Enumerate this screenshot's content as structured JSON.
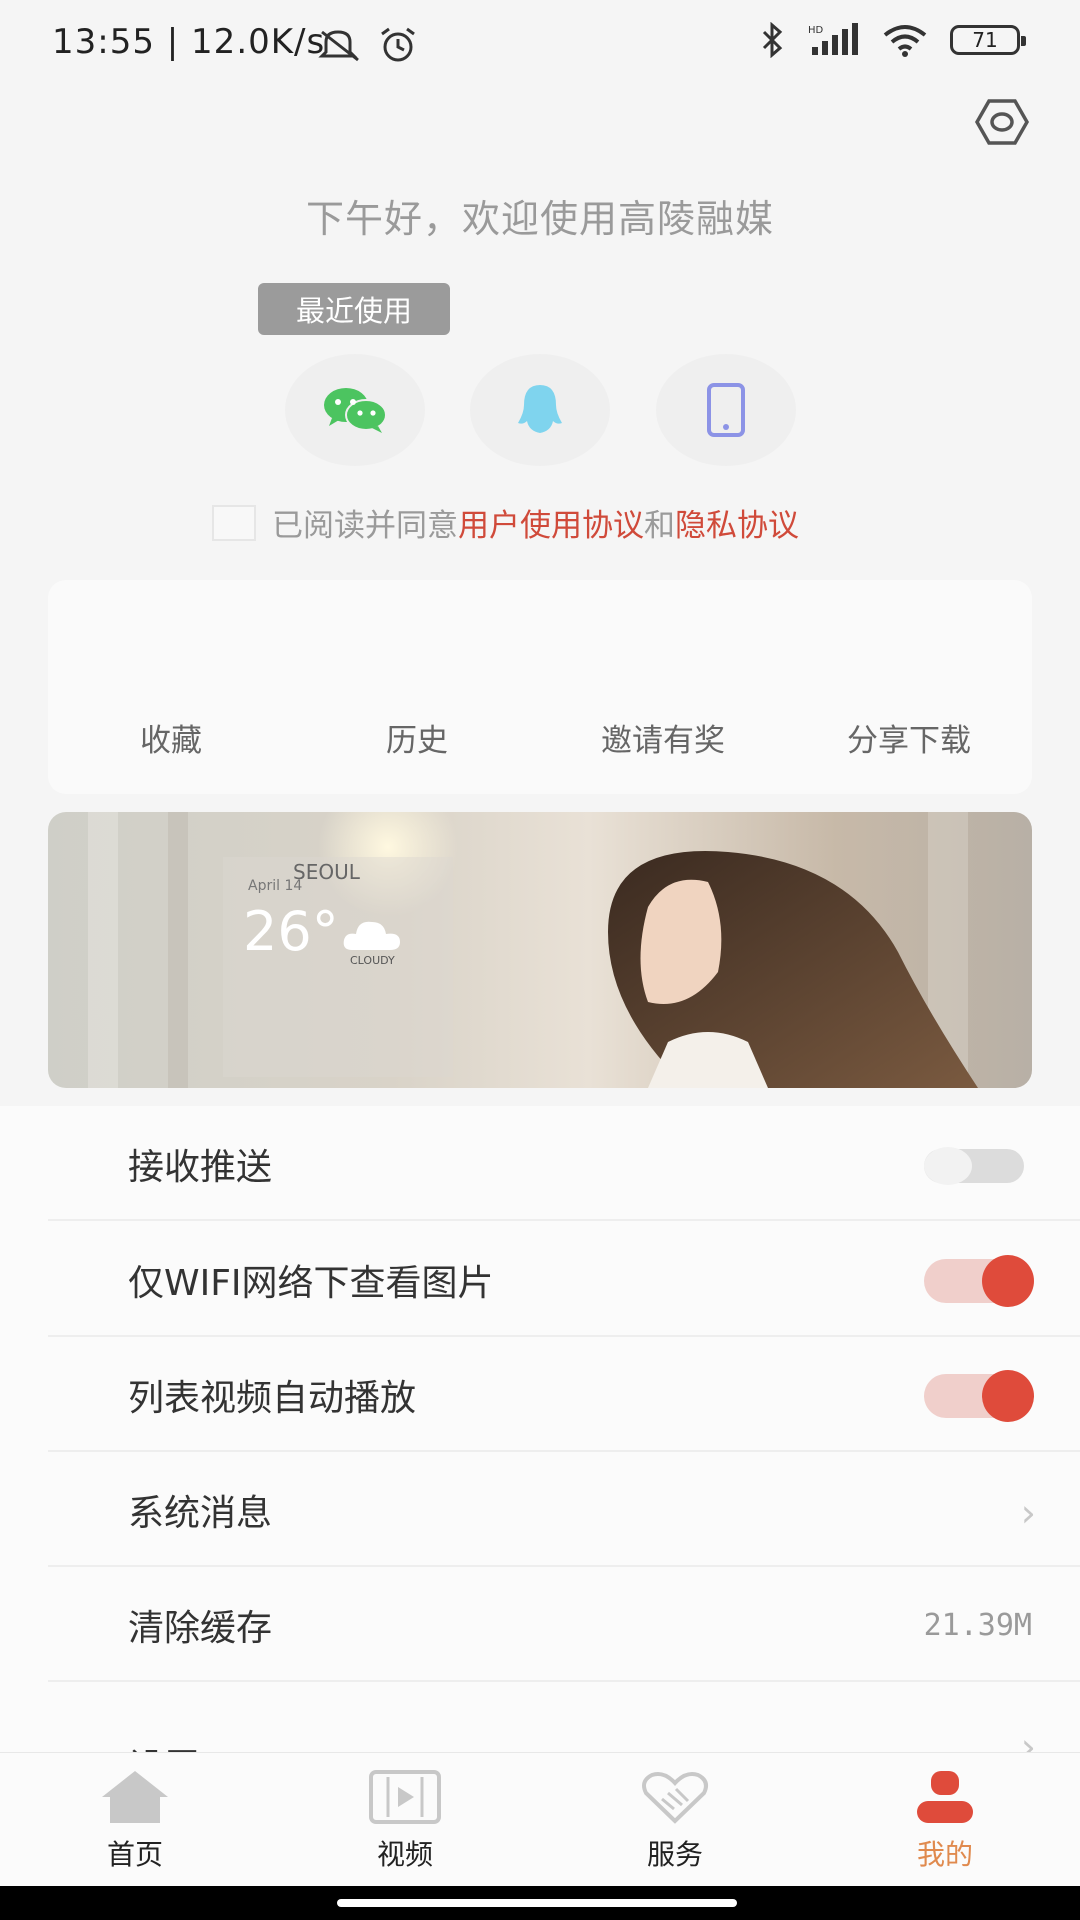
{
  "status_bar": {
    "time": "13:55 | 12.0K/s",
    "battery": "71"
  },
  "header": {
    "greeting": "下午好，欢迎使用高陵融媒",
    "recent_tag": "最近使用"
  },
  "login_options": [
    {
      "icon": "wechat-icon",
      "color": "#4cc460"
    },
    {
      "icon": "qq-icon",
      "color": "#7fd4ee"
    },
    {
      "icon": "phone-icon",
      "color": "#8c93e6"
    }
  ],
  "agreement": {
    "prefix": "已阅读并同意",
    "user_agreement": "用户使用协议",
    "and": "和",
    "privacy": "隐私协议"
  },
  "quick_actions": [
    "收藏",
    "历史",
    "邀请有奖",
    "分享下载"
  ],
  "banner": {
    "city": "SEOUL",
    "date": "April 14",
    "temperature": "26°",
    "condition": "CLOUDY"
  },
  "settings": {
    "push": {
      "label": "接收推送",
      "enabled": false
    },
    "wifi_images": {
      "label": "仅WIFI网络下查看图片",
      "enabled": true
    },
    "autoplay": {
      "label": "列表视频自动播放",
      "enabled": true
    },
    "messages": {
      "label": "系统消息"
    },
    "cache": {
      "label": "清除缓存",
      "value": "21.39M"
    },
    "settings": {
      "label": "设置"
    }
  },
  "bottom_nav": [
    {
      "label": "首页",
      "icon": "home-icon",
      "active": false
    },
    {
      "label": "视频",
      "icon": "video-icon",
      "active": false
    },
    {
      "label": "服务",
      "icon": "handshake-icon",
      "active": false
    },
    {
      "label": "我的",
      "icon": "user-icon",
      "active": true
    }
  ],
  "colors": {
    "accent_red": "#df4b3b",
    "active_nav": "#e08a4e",
    "link_red": "#d04a3a"
  }
}
